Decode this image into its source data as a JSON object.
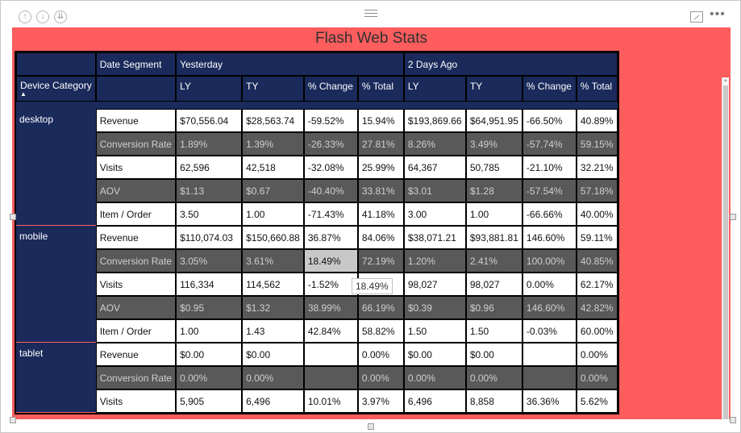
{
  "window": {
    "title": "Flash Web Stats"
  },
  "matrix": {
    "header_row1": {
      "corner": "",
      "date_segment_label": "Date Segment",
      "group1": "Yesterday",
      "group2": "2 Days Ago"
    },
    "header_row2": {
      "device_category_label": "Device Category",
      "columns": [
        "LY",
        "TY",
        "% Change",
        "% Total",
        "LY",
        "TY",
        "% Change",
        "% Total"
      ]
    },
    "categories": [
      {
        "name": "desktop",
        "rows": [
          {
            "metric": "Revenue",
            "values": [
              "$70,556.04",
              "$28,563.74",
              "-59.52%",
              "15.94%",
              "$193,869.66",
              "$64,951.95",
              "-66.50%",
              "40.89%"
            ]
          },
          {
            "metric": "Conversion Rate",
            "values": [
              "1.89%",
              "1.39%",
              "-26.33%",
              "27.81%",
              "8.26%",
              "3.49%",
              "-57.74%",
              "59.15%"
            ]
          },
          {
            "metric": "Visits",
            "values": [
              "62,596",
              "42,518",
              "-32.08%",
              "25.99%",
              "64,367",
              "50,785",
              "-21.10%",
              "32.21%"
            ]
          },
          {
            "metric": "AOV",
            "values": [
              "$1.13",
              "$0.67",
              "-40.40%",
              "33.81%",
              "$3.01",
              "$1.28",
              "-57.54%",
              "57.18%"
            ]
          },
          {
            "metric": "Item / Order",
            "values": [
              "3.50",
              "1.00",
              "-71.43%",
              "41.18%",
              "3.00",
              "1.00",
              "-66.66%",
              "40.00%"
            ]
          }
        ]
      },
      {
        "name": "mobile",
        "rows": [
          {
            "metric": "Revenue",
            "values": [
              "$110,074.03",
              "$150,660.88",
              "36.87%",
              "84.06%",
              "$38,071.21",
              "$93,881.81",
              "146.60%",
              "59.11%"
            ]
          },
          {
            "metric": "Conversion Rate",
            "values": [
              "3.05%",
              "3.61%",
              "18.49%",
              "72.19%",
              "1.20%",
              "2.41%",
              "100.00%",
              "40.85%"
            ]
          },
          {
            "metric": "Visits",
            "values": [
              "116,334",
              "114,562",
              "-1.52%",
              "",
              "98,027",
              "98,027",
              "0.00%",
              "62.17%"
            ]
          },
          {
            "metric": "AOV",
            "values": [
              "$0.95",
              "$1.32",
              "38.99%",
              "66.19%",
              "$0.39",
              "$0.96",
              "146.60%",
              "42.82%"
            ]
          },
          {
            "metric": "Item / Order",
            "values": [
              "1.00",
              "1.43",
              "42.84%",
              "58.82%",
              "1.50",
              "1.50",
              "-0.03%",
              "60.00%"
            ]
          }
        ]
      },
      {
        "name": "tablet",
        "rows": [
          {
            "metric": "Revenue",
            "values": [
              "$0.00",
              "$0.00",
              "",
              "0.00%",
              "$0.00",
              "$0.00",
              "",
              "0.00%"
            ]
          },
          {
            "metric": "Conversion Rate",
            "values": [
              "0.00%",
              "0.00%",
              "",
              "0.00%",
              "0.00%",
              "0.00%",
              "",
              "0.00%"
            ]
          },
          {
            "metric": "Visits",
            "values": [
              "5,905",
              "6,496",
              "10.01%",
              "3.97%",
              "6,496",
              "8,858",
              "36.36%",
              "5.62%"
            ]
          }
        ]
      }
    ],
    "tooltip": "18.49%"
  },
  "colors": {
    "canvas": "#fd5d5d",
    "header": "#1a2a5b",
    "row_alt": "#595959"
  }
}
